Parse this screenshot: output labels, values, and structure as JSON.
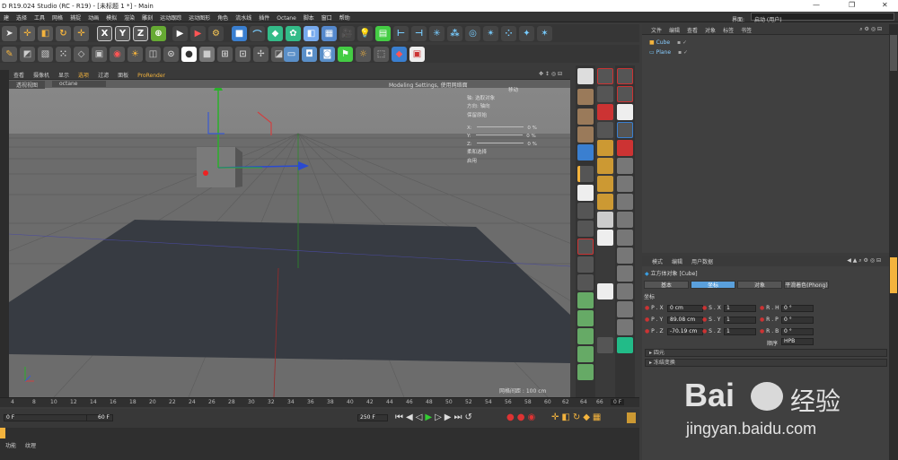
{
  "window": {
    "title": "D R19.024 Studio (RC - R19) - [未标题 1 *] - Main",
    "controls": [
      "—",
      "❐",
      "✕"
    ]
  },
  "menu": {
    "items": [
      "建",
      "选择",
      "工具",
      "网格",
      "捕捉",
      "动画",
      "模拟",
      "渲染",
      "雕刻",
      "运动跟踪",
      "运动图形",
      "角色",
      "流水线",
      "插件",
      "Octane",
      "脚本",
      "窗口",
      "帮助"
    ],
    "interface_label": "界面:",
    "interface_value": "启动 (用户)"
  },
  "viewport": {
    "menu": [
      "查看",
      "摄像机",
      "显示",
      "选项",
      "过滤",
      "面板",
      "ProRender"
    ],
    "tabs": [
      "透视视图",
      "octane"
    ],
    "hud_title": "Modeling Settings, 使用网络面",
    "grid_label": "网格间距 : 100 cm",
    "overlay": {
      "mode": "移动",
      "axis": "轴: 选取对象",
      "dir": "方向: 轴向",
      "keep": "保留原始",
      "x_label": "X:",
      "x_val": "0 %",
      "y_label": "Y:",
      "y_val": "0 %",
      "z_label": "Z:",
      "z_val": "0 %",
      "soft": "柔和选择",
      "enable": "启用"
    }
  },
  "objects": {
    "menu": [
      "文件",
      "编辑",
      "查看",
      "对象",
      "标签",
      "书签"
    ],
    "items": [
      {
        "name": "Cube"
      },
      {
        "name": "Plane"
      }
    ]
  },
  "attributes": {
    "menu": [
      "模式",
      "编辑",
      "用户数据"
    ],
    "object_title": "立方体对象 [Cube]",
    "tabs": [
      "基本",
      "坐标",
      "对象",
      "平滑着色(Phong)"
    ],
    "active_tab": 1,
    "section": "坐标",
    "rows": [
      {
        "p_label": "P . X",
        "p_val": "0 cm",
        "s_label": "S . X",
        "s_val": "1",
        "r_label": "R . H",
        "r_val": "0 °"
      },
      {
        "p_label": "P . Y",
        "p_val": "89.08 cm",
        "s_label": "S . Y",
        "s_val": "1",
        "r_label": "R . P",
        "r_val": "0 °"
      },
      {
        "p_label": "P . Z",
        "p_val": "-70.19 cm",
        "s_label": "S . Z",
        "s_val": "1",
        "r_label": "R . B",
        "r_val": "0 °"
      }
    ],
    "order_label": "顺序",
    "order_value": "HPB",
    "sections": [
      "四元",
      "冻结变换"
    ]
  },
  "timeline": {
    "ticks": [
      "4",
      "8",
      "10",
      "12",
      "14",
      "16",
      "18",
      "20",
      "22",
      "24",
      "26",
      "28",
      "30",
      "32",
      "34",
      "36",
      "38",
      "40",
      "42",
      "44",
      "46",
      "48",
      "50",
      "52",
      "54",
      "56",
      "58",
      "60",
      "62",
      "64",
      "66",
      "68"
    ],
    "current_frame": "0 F",
    "start_field": "0 F",
    "end_field": "60 F",
    "max_field": "250 F"
  },
  "bottom_tabs": [
    "功能",
    "纹理"
  ],
  "watermark": {
    "brand": "Bai",
    "mid": "经验",
    "url": "jingyan.baidu.com"
  }
}
